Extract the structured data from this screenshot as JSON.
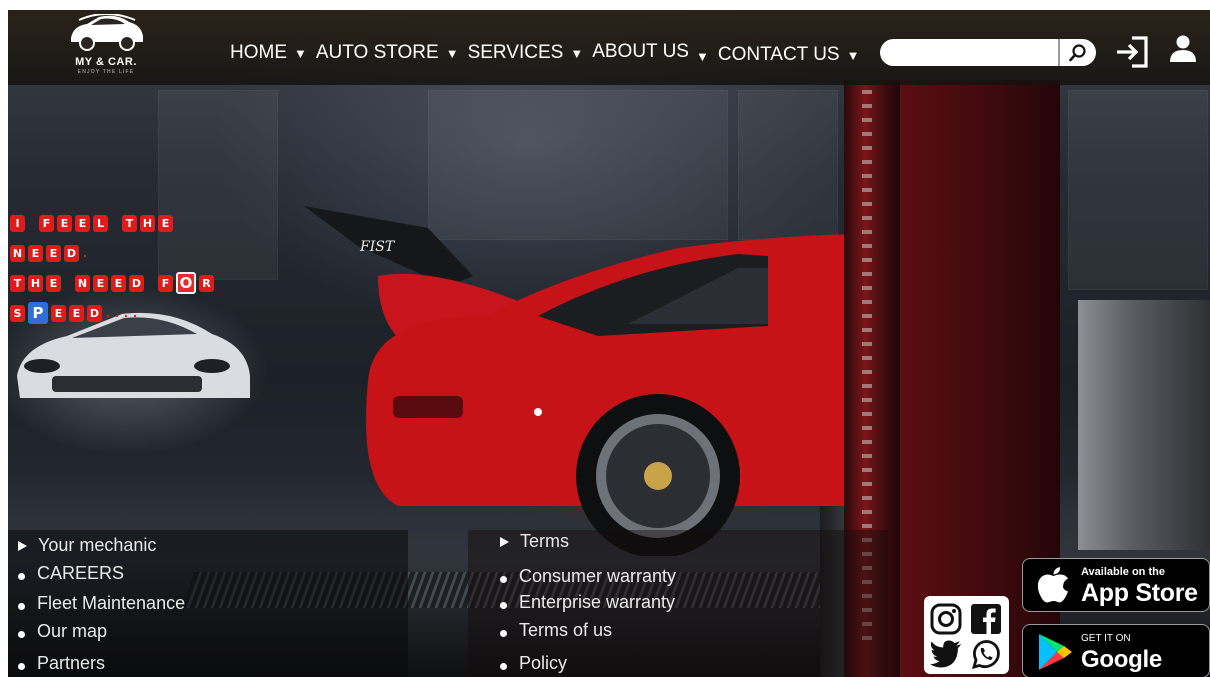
{
  "header": {
    "logo": {
      "name": "MY & CAR.",
      "tagline": "ENJOY THE LIFE"
    },
    "nav": [
      {
        "label": "HOME",
        "caret": "▼"
      },
      {
        "label": "AUTO STORE",
        "caret": "▼"
      },
      {
        "label": "SERVICES",
        "caret": "▼"
      },
      {
        "label": "ABOUT US",
        "caret": "▼"
      },
      {
        "label": "CONTACT US",
        "caret": "▼"
      }
    ],
    "search": {
      "value": "",
      "placeholder": "",
      "button_icon": "search-icon"
    },
    "actions": [
      "login-icon",
      "user-icon"
    ]
  },
  "hero": {
    "slogan_lines": [
      "I FEEL THE",
      "NEED.",
      "THE NEED FOR",
      "SPEED...."
    ]
  },
  "footer": {
    "column_left": [
      "Your mechanic",
      "CAREERS",
      "Fleet Maintenance",
      "Our map",
      "Partners"
    ],
    "column_middle": [
      "Terms",
      "Consumer warranty",
      "Enterprise warranty",
      "Terms of us",
      "Policy"
    ],
    "social_icons": [
      "instagram-icon",
      "facebook-icon",
      "twitter-icon",
      "whatsapp-icon"
    ],
    "app_store": {
      "small": "Available on the",
      "big": "App Store"
    },
    "google_play": {
      "small": "GET IT ON",
      "big": "Google Play"
    }
  },
  "colors": {
    "accent_red": "#e01b1b",
    "accent_blue": "#2f6fd6",
    "header_bg": "#221d16"
  }
}
